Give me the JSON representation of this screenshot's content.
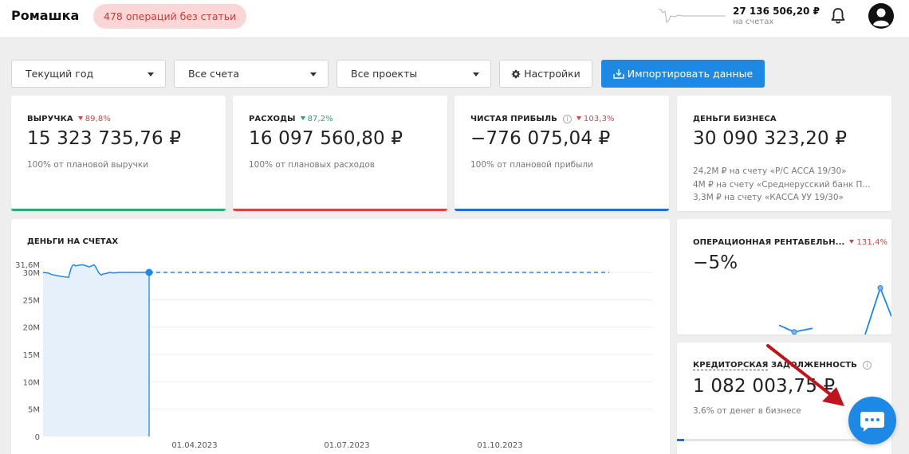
{
  "header": {
    "company": "Ромашка",
    "ops_badge": "478 операций без статьи",
    "balance_value": "27 136 506,20 ₽",
    "balance_sub": "на счетах"
  },
  "filters": {
    "period": "Текущий год",
    "accounts": "Все счета",
    "projects": "Все проекты",
    "settings": "Настройки",
    "import": "Импортировать данные"
  },
  "kpi": {
    "revenue": {
      "label": "ВЫРУЧКА",
      "delta": "89,8%",
      "value": "15 323 735,76 ₽",
      "note": "100% от плановой выручки",
      "color": "#2eaa78"
    },
    "expenses": {
      "label": "РАСХОДЫ",
      "delta": "87,2%",
      "value": "16 097 560,80 ₽",
      "note": "100% от плановых расходов",
      "color": "#d64545"
    },
    "profit": {
      "label": "ЧИСТАЯ ПРИБЫЛЬ",
      "delta": "103,3%",
      "value": "−776 075,04 ₽",
      "note": "100% от плановой прибыли",
      "color": "#1e6fd1"
    },
    "business_money": {
      "label": "ДЕНЬГИ БИЗНЕСА",
      "value": "30 090 323,20 ₽",
      "lines": [
        "24,2M ₽ на счету «Р/С АССА 19/30»",
        "4M ₽ на счету «Среднерусский банк П...",
        "3,3M ₽ на счету «КАССА УУ 19/30»"
      ]
    },
    "op_margin": {
      "label": "ОПЕРАЦИОННАЯ РЕНТАБЕЛЬН...",
      "delta": "131,4%",
      "value": "−5%"
    },
    "payables": {
      "label_underlined": "КРЕДИТОРСКАЯ",
      "label_rest": " ЗАДОЛЖЕННОСТЬ",
      "value": "1 082 003,75 ₽",
      "note": "3,6% от денег в бизнесе"
    }
  },
  "chart_data": {
    "type": "area",
    "title": "ДЕНЬГИ НА СЧЕТАХ",
    "y_ticks": [
      "0",
      "5M",
      "10M",
      "15M",
      "20M",
      "25M",
      "30M"
    ],
    "y_max_label": "31,6M",
    "ylim": [
      0,
      31600000
    ],
    "x_ticks": [
      "01.04.2023",
      "01.07.2023",
      "01.10.2023"
    ],
    "actual": {
      "x": [
        0,
        6,
        11,
        18,
        26,
        32,
        35,
        37,
        39,
        41,
        44,
        50,
        58,
        64,
        66,
        70,
        73,
        75,
        79,
        84,
        89,
        94,
        101,
        110,
        120,
        133
      ],
      "y": [
        30000000,
        29900000,
        29600000,
        29400000,
        29200000,
        29100000,
        30700000,
        31300000,
        31400000,
        31200000,
        31300000,
        31400000,
        31000000,
        31400000,
        31000000,
        29900000,
        29500000,
        29700000,
        29800000,
        30000000,
        29900000,
        30000000,
        30000000,
        30000000,
        30000000,
        30000000
      ]
    },
    "forecast": {
      "from_x": 133,
      "to_x": 710,
      "y": 30000000
    },
    "x_unit_days_per_tick": 91,
    "colors": {
      "line": "#1e88e5",
      "fill": "#e6f0fb",
      "forecast": "#1e88e5"
    }
  },
  "mini_chart": {
    "values": [
      0.18,
      0.05,
      0.12,
      0.0,
      0.9,
      0.35
    ]
  }
}
